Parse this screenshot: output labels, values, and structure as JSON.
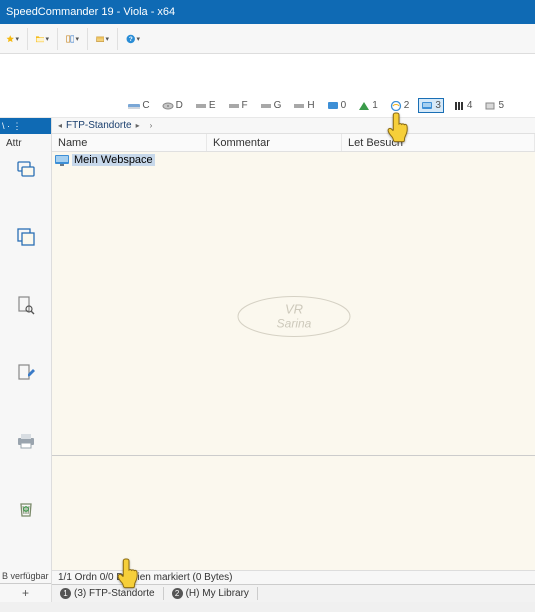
{
  "title": "SpeedCommander 19 - Viola - x64",
  "drives": {
    "c": "C",
    "d": "D",
    "e": "E",
    "f": "F",
    "g": "G",
    "h": "H",
    "n0": "0",
    "n1": "1",
    "n2": "2",
    "n3": "3",
    "n4": "4",
    "n5": "5"
  },
  "left": {
    "head": "\\ · ⋮",
    "attr": "Attr",
    "status": "B verfügbar",
    "plus": "+"
  },
  "breadcrumb": {
    "label": "FTP-Standorte"
  },
  "columns": {
    "name": "Name",
    "kommentar": "Kommentar",
    "lb": "Let      Besuch"
  },
  "file": {
    "name": "Mein Webspace"
  },
  "status2": "1/1 Ordn    0/0 Dateien markiert (0 Bytes)",
  "tabs": {
    "t1": "(3) FTP-Standorte",
    "t2": "(H) My Library",
    "n1": "1",
    "n2": "2"
  }
}
